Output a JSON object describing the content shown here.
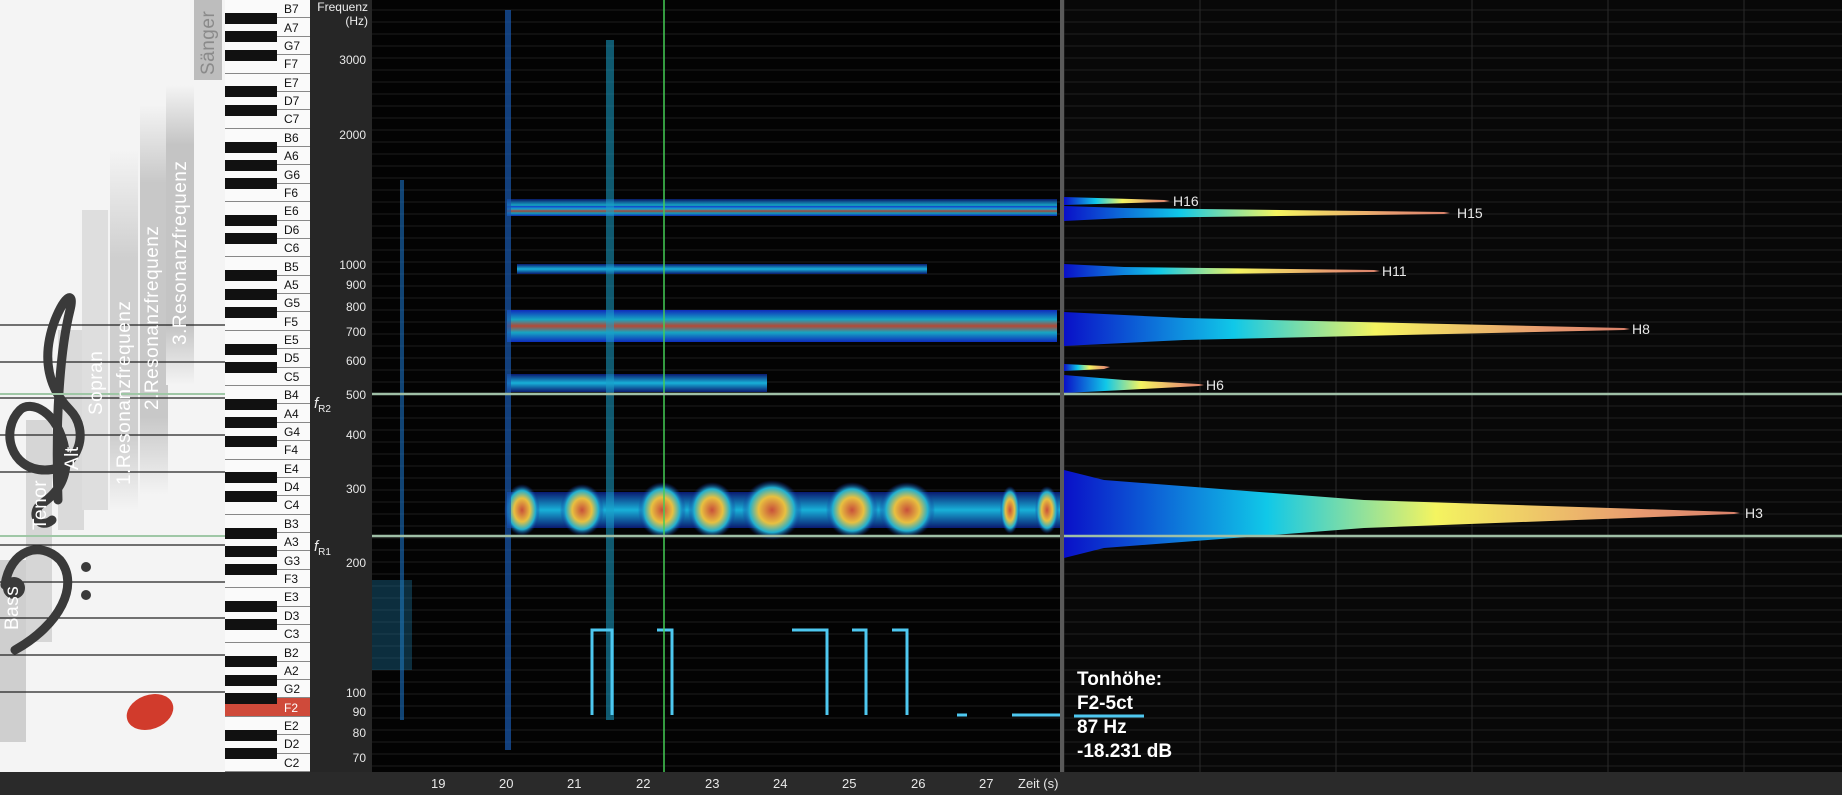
{
  "staff": {
    "voice_labels": [
      "Bass",
      "Tenor",
      "Alt",
      "Sopran",
      "1.Resonanzfrequenz",
      "2.Resonanzfrequenz",
      "3.Resonanzfrequenz",
      "Sänger"
    ],
    "note_color": "#d13b2c"
  },
  "keyboard": {
    "keys": [
      "B7",
      "A7",
      "G7",
      "F7",
      "E7",
      "D7",
      "C7",
      "B6",
      "A6",
      "G6",
      "F6",
      "E6",
      "D6",
      "C6",
      "B5",
      "A5",
      "G5",
      "F5",
      "E5",
      "D5",
      "C5",
      "B4",
      "A4",
      "G4",
      "F4",
      "E4",
      "D4",
      "C4",
      "B3",
      "A3",
      "G3",
      "F3",
      "E3",
      "D3",
      "C3",
      "B2",
      "A2",
      "G2",
      "F2",
      "E2",
      "D2",
      "C2"
    ],
    "highlighted_key": "F2",
    "highlight_color": "#cf4a3a"
  },
  "axis": {
    "title_line1": "Frequenz",
    "title_line2": "(Hz)",
    "ticks": [
      "3000",
      "2000",
      "1000",
      "900",
      "800",
      "700",
      "600",
      "500",
      "400",
      "300",
      "200",
      "100",
      "90",
      "80",
      "70"
    ],
    "scale": "log"
  },
  "resonance": {
    "f_r1": {
      "symbol": "f",
      "sub": "R1"
    },
    "f_r2": {
      "symbol": "f",
      "sub": "R2"
    }
  },
  "time_axis": {
    "ticks": [
      "19",
      "20",
      "21",
      "22",
      "23",
      "24",
      "25",
      "26",
      "27"
    ],
    "label": "Zeit (s)"
  },
  "harmonics": {
    "labels": [
      "H16",
      "H15",
      "H11",
      "H8",
      "H6",
      "H3"
    ]
  },
  "info": {
    "title": "Tonhöhe:",
    "note": "F2-5ct",
    "frequency": "87 Hz",
    "level": "-18.231 dB"
  },
  "colors": {
    "background": "#1b1b1b",
    "spectrum_hot": "#c8503a",
    "spectrum_cold": "#1020c0",
    "pitch_trace": "#4ec8f0",
    "cursor_line": "#44cc55"
  }
}
